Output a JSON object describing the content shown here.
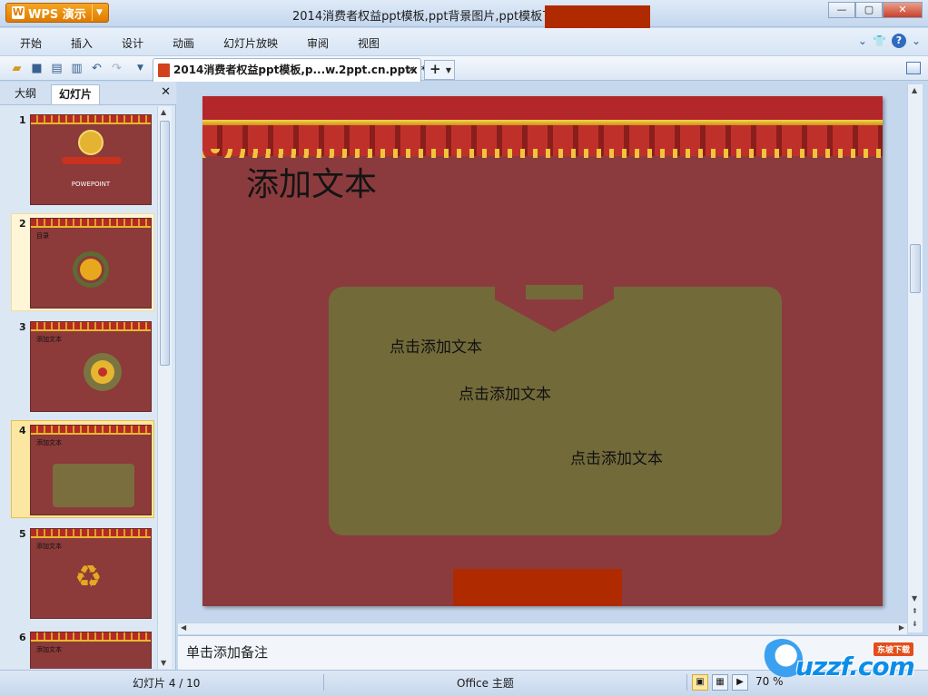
{
  "app": {
    "logo_label": "WPS 演示",
    "window_title": "2014消费者权益ppt模板,ppt背景图片,ppt模板下载-"
  },
  "window_controls": {
    "minimize": "—",
    "maximize": "▢",
    "close": "✕"
  },
  "menu": {
    "items": [
      "开始",
      "插入",
      "设计",
      "动画",
      "幻灯片放映",
      "审阅",
      "视图"
    ]
  },
  "toolbar": {
    "doc_tab_label": "2014消费者权益ppt模板,p...w.2ppt.cn.pptx *",
    "doc_tab_close": "✕",
    "new_tab_label": "+"
  },
  "left_panel": {
    "tabs": [
      "大纲",
      "幻灯片"
    ],
    "active_tab": "幻灯片",
    "close_label": "✕",
    "thumbnails": [
      {
        "number": "1",
        "title": "",
        "caption": "POWEPOINT"
      },
      {
        "number": "2",
        "title": "目录"
      },
      {
        "number": "3",
        "title": "添加文本"
      },
      {
        "number": "4",
        "title": "添加文本"
      },
      {
        "number": "5",
        "title": "添加文本"
      },
      {
        "number": "6",
        "title": "添加文本"
      }
    ],
    "selected_index": 4
  },
  "slide": {
    "title": "添加文本",
    "text_1": "点击添加文本",
    "text_2": "点击添加文本",
    "text_3": "点击添加文本"
  },
  "notes": {
    "placeholder": "单击添加备注"
  },
  "status": {
    "slide_position": "幻灯片 4 / 10",
    "theme": "Office 主题",
    "zoom": "70 %"
  },
  "watermark": {
    "brand": "uzzf.com",
    "tag": "东坡下载"
  },
  "colors": {
    "slide_bg": "#8b3b3e",
    "content_box": "#736a3a",
    "redaction": "#b02a00",
    "wps_orange": "#e07b00"
  }
}
